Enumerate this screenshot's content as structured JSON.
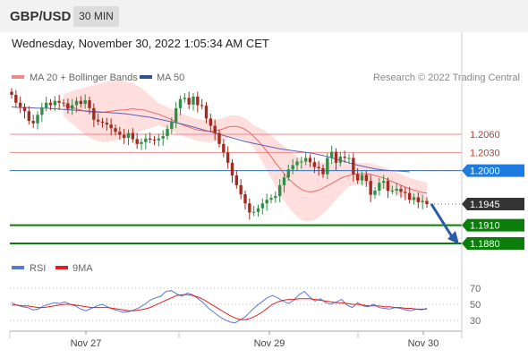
{
  "header": {
    "symbol": "GBP/USD",
    "interval": "30 MIN",
    "datetime": "Wednesday, November 30, 2022 1:05:34 AM CET"
  },
  "legend": {
    "ma20_label": "MA 20 + Bollinger Bands",
    "ma50_label": "MA 50",
    "source": "Research © 2022 Trading Central"
  },
  "colors": {
    "up": "#2f8f47",
    "down": "#a32a1e",
    "bb": "#ffd6d6",
    "ma20": "#e86a6a",
    "ma50": "#5a63b8",
    "resistance": "#f08a8a",
    "pivot": "#2a6fc4",
    "support": "#0a7d0a",
    "last": "#333333",
    "rsi": "#5a78d6",
    "rsi_ma": "#e02020"
  },
  "chart_data": [
    {
      "type": "candlestick",
      "x_tick_labels": [
        "Nov 27",
        "Nov 29",
        "Nov 30"
      ],
      "last_price": "1.1945",
      "levels": [
        {
          "value": 1.206,
          "label": "1.2060",
          "kind": "resistance"
        },
        {
          "value": 1.203,
          "label": "1.2030",
          "kind": "resistance"
        },
        {
          "value": 1.2,
          "label": "1.2000",
          "kind": "pivot"
        },
        {
          "value": 1.191,
          "label": "1.1910",
          "kind": "support"
        },
        {
          "value": 1.188,
          "label": "1.1880",
          "kind": "support"
        }
      ],
      "forecast": {
        "from": 1.1945,
        "to": 1.188
      },
      "closes": [
        1.2125,
        1.2112,
        1.2105,
        1.2098,
        1.2082,
        1.2078,
        1.2092,
        1.2104,
        1.2112,
        1.2108,
        1.2115,
        1.2112,
        1.2111,
        1.2102,
        1.2108,
        1.2115,
        1.211,
        1.2116,
        1.2103,
        1.2084,
        1.2081,
        1.2079,
        1.2076,
        1.207,
        1.2064,
        1.2059,
        1.2054,
        1.2062,
        1.2052,
        1.2044,
        1.2047,
        1.2053,
        1.2051,
        1.205,
        1.2053,
        1.2057,
        1.2069,
        1.208,
        1.2103,
        1.2118,
        1.212,
        1.2109,
        1.2122,
        1.2108,
        1.2107,
        1.2086,
        1.2074,
        1.2062,
        1.2044,
        1.203,
        1.2013,
        1.1992,
        1.1976,
        1.1961,
        1.1946,
        1.1931,
        1.1932,
        1.1938,
        1.1946,
        1.1952,
        1.1955,
        1.1958,
        1.1976,
        1.1989,
        1.2002,
        1.2009,
        1.2015,
        1.2015,
        1.2021,
        1.2014,
        1.2006,
        1.2004,
        1.1994,
        1.2021,
        1.2031,
        1.2013,
        1.2023,
        1.2021,
        1.2021,
        1.1994,
        1.1984,
        1.1993,
        1.1983,
        1.196,
        1.1967,
        1.198,
        1.1983,
        1.1967,
        1.1967,
        1.197,
        1.1965,
        1.1963,
        1.1952,
        1.1956,
        1.1948,
        1.195,
        1.1945
      ],
      "ma20": [
        1.2108,
        1.2106,
        1.2104,
        1.2102,
        1.21,
        1.2098,
        1.2097,
        1.2096,
        1.2096,
        1.2096,
        1.2097,
        1.2098,
        1.2099,
        1.21,
        1.21,
        1.2101,
        1.2102,
        1.2101,
        1.2101,
        1.2099,
        1.2097,
        1.2095,
        1.2093,
        1.209,
        1.2087,
        1.2084,
        1.208,
        1.2077,
        1.2074,
        1.2072,
        1.2069,
        1.2067,
        1.2066,
        1.2065,
        1.2065,
        1.2066,
        1.2067,
        1.2069,
        1.2072,
        1.2073,
        1.2073,
        1.2071,
        1.2068,
        1.2063,
        1.2056,
        1.2049,
        1.2041,
        1.2032,
        1.2023,
        1.2013,
        1.2004,
        1.1995,
        1.1987,
        1.198,
        1.1974,
        1.1969,
        1.1966,
        1.1965,
        1.1966,
        1.1968,
        1.1971,
        1.1975,
        1.1979,
        1.1983,
        1.1987,
        1.199,
        1.1992,
        1.1994,
        1.1995,
        1.1995,
        1.1995,
        1.1994,
        1.1992,
        1.199,
        1.1988,
        1.1985,
        1.1982,
        1.1979,
        1.1976,
        1.1973,
        1.197,
        1.1968,
        1.1966,
        1.1964,
        1.1963
      ],
      "ma50": [
        1.2105,
        1.2104,
        1.2104,
        1.2103,
        1.2103,
        1.2102,
        1.2101,
        1.21,
        1.2099,
        1.2098,
        1.2097,
        1.2096,
        1.2095,
        1.2094,
        1.2092,
        1.209,
        1.2088,
        1.2085,
        1.2082,
        1.2079,
        1.2076,
        1.2072,
        1.2068,
        1.2064,
        1.206,
        1.2056,
        1.2052,
        1.2048,
        1.2045,
        1.2042,
        1.2039,
        1.2036,
        1.2034,
        1.2032,
        1.203,
        1.2028,
        1.2025,
        1.2021,
        1.2017,
        1.2013,
        1.2009,
        1.2006,
        1.2003,
        1.2001,
        1.2,
        1.1999,
        1.1998
      ]
    },
    {
      "type": "line",
      "legend": [
        "RSI",
        "9MA"
      ],
      "y_tick_labels": [
        "70",
        "50",
        "30"
      ],
      "y_range": [
        20,
        80
      ],
      "rsi": [
        52,
        49,
        47,
        46,
        43,
        44,
        48,
        50,
        52,
        51,
        53,
        50,
        48,
        44,
        42,
        45,
        48,
        50,
        47,
        44,
        42,
        40,
        41,
        43,
        46,
        50,
        55,
        58,
        60,
        66,
        67,
        63,
        60,
        64,
        62,
        57,
        52,
        45,
        40,
        35,
        31,
        28,
        27,
        31,
        35,
        42,
        48,
        53,
        58,
        61,
        58,
        54,
        51,
        55,
        62,
        66,
        59,
        54,
        57,
        52,
        50,
        53,
        56,
        49,
        46,
        52,
        48,
        47,
        50,
        46,
        45,
        44,
        46,
        45,
        43,
        42,
        44,
        43,
        45
      ],
      "rsi_ma": [
        49,
        49,
        48,
        48,
        47,
        46,
        46,
        47,
        48,
        49,
        50,
        50,
        49,
        48,
        47,
        46,
        46,
        46,
        46,
        45,
        44,
        43,
        42,
        42,
        43,
        44,
        46,
        49,
        52,
        55,
        58,
        61,
        62,
        62,
        61,
        59,
        56,
        52,
        48,
        44,
        40,
        36,
        33,
        31,
        31,
        33,
        36,
        40,
        45,
        50,
        53,
        55,
        56,
        56,
        57,
        57,
        57,
        56,
        55,
        54,
        53,
        52,
        52,
        51,
        50,
        50,
        49,
        48,
        48,
        48,
        47,
        47,
        46,
        46,
        45,
        45,
        44,
        44,
        44
      ]
    }
  ]
}
